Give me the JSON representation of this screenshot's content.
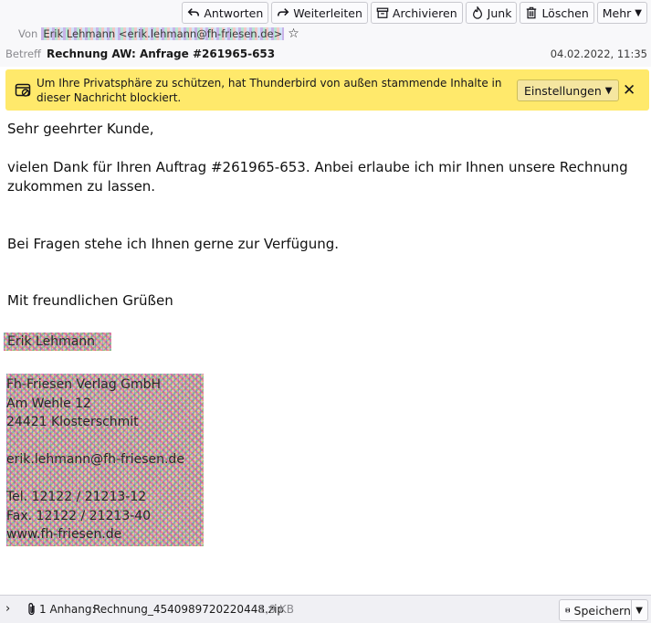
{
  "toolbar": {
    "reply_label": "Antworten",
    "forward_label": "Weiterleiten",
    "archive_label": "Archivieren",
    "junk_label": "Junk",
    "delete_label": "Löschen",
    "more_label": "Mehr"
  },
  "header": {
    "from_label": "Von",
    "from_value": "Erik Lehmann <erik.lehmann@fh-friesen.de>",
    "subject_label": "Betreff",
    "subject_value": "Rechnung AW: Anfrage #261965-653",
    "date": "04.02.2022, 11:35"
  },
  "banner": {
    "text": "Um Ihre Privatsphäre zu schützen, hat Thunderbird von außen stammende Inhalte in dieser Nachricht blockiert.",
    "settings_label": "Einstellungen",
    "close_label": "✕"
  },
  "body": {
    "greeting": "Sehr geehrter Kunde,",
    "paragraph1": "vielen Dank für Ihren Auftrag #261965-653. Anbei erlaube ich mir Ihnen unsere Rechnung zukommen zu lassen.",
    "paragraph2": "Bei Fragen stehe ich Ihnen gerne zur Verfügung.",
    "closing": "Mit freundlichen Grüßen",
    "signature_name": "Erik Lehmann",
    "signature_lines": [
      "Fh-Friesen Verlag GmbH",
      "Am Wehle 12",
      "24421 Klosterschmit",
      "",
      "erik.lehmann@fh-friesen.de",
      "",
      "Tel. 12122 / 21213-12",
      "Fax. 12122 / 21213-40",
      "www.fh-friesen.de"
    ]
  },
  "footer": {
    "attachment_count": "1 Anhang:",
    "attachment_name": "Rechnung_4540989720220448.zip",
    "attachment_size": "1,9 KB",
    "save_label": "Speichern"
  }
}
